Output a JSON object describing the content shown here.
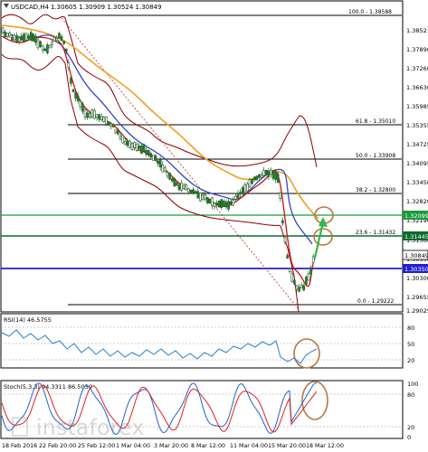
{
  "header": {
    "title": "USDCAD,H4",
    "ohlc": "1.30605 1.30909 1.30524 1.30849"
  },
  "price_axis": {
    "labels": [
      "1.38521",
      "1.37890",
      "1.37260",
      "1.36630",
      "1.35985",
      "1.35355",
      "1.34725",
      "1.34095",
      "1.33450",
      "1.32820",
      "1.32190",
      "1.31560",
      "1.30930",
      "1.30300",
      "1.29655",
      "1.29025"
    ]
  },
  "levels": {
    "fib": [
      {
        "label": "100.0 - 1.38588",
        "price": 1.38588
      },
      {
        "label": "61.8 - 1.35010",
        "price": 1.3501
      },
      {
        "label": "50.0 - 1.33908",
        "price": 1.33908
      },
      {
        "label": "38.2 - 1.32800",
        "price": 1.328
      },
      {
        "label": "23.6 - 1.31432",
        "price": 1.31432
      },
      {
        "label": "0.0 - 1.29222",
        "price": 1.29222
      }
    ],
    "green_upper": {
      "label": "1.32099",
      "price": 1.32099,
      "color": "#1a9a3a"
    },
    "green_lower": {
      "label": "1.31445",
      "price": 1.31445,
      "color": "#0d6b2a"
    },
    "blue": {
      "label": "1.30350",
      "price": 1.3035,
      "color": "#1f1fd0"
    },
    "current": {
      "label": "1.30849",
      "price": 1.30849
    }
  },
  "rsi": {
    "title": "RSI(14) 46.5755",
    "axis": [
      "80",
      "50",
      "20"
    ]
  },
  "stoch": {
    "title": "Stoch(5,3,3) 94.3311 86.5050",
    "axis": [
      "100",
      "80",
      "20",
      "0"
    ]
  },
  "time_axis": {
    "labels": [
      "18 Feb 2016",
      "22 Feb 20:00",
      "25 Feb 12:00",
      "1 Mar 04:00",
      "3 Mar 20:00",
      "8 Mar 12:00",
      "11 Mar 04:00",
      "15 Mar 20:00",
      "18 Mar 12:00"
    ]
  },
  "watermark": "instaforex",
  "colors": {
    "candle": "#2e7d32",
    "ma_red": "#cc1111",
    "ma_blue": "#3344cc",
    "ma_orange": "#f0a020",
    "bollinger": "#8b0000",
    "rsi_line": "#2a7fd0",
    "stoch_main": "#1e63d0",
    "stoch_signal": "#e02020",
    "annotation": "#b87840"
  }
}
